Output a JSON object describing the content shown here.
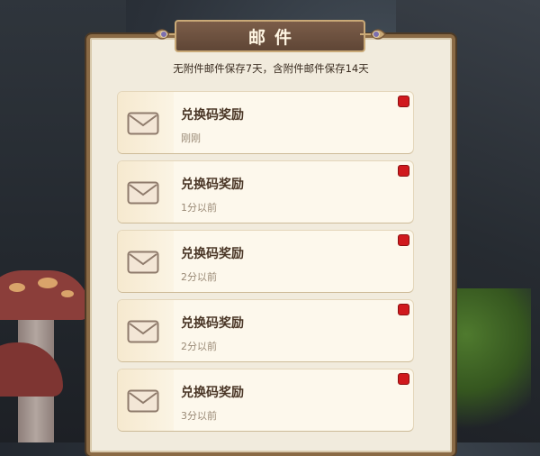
{
  "header": {
    "title": "邮件"
  },
  "notice": "无附件邮件保存7天，含附件邮件保存14天",
  "mails": [
    {
      "title": "兑换码奖励",
      "time": "刚刚",
      "unread": true
    },
    {
      "title": "兑换码奖励",
      "time": "1分以前",
      "unread": true
    },
    {
      "title": "兑换码奖励",
      "time": "2分以前",
      "unread": true
    },
    {
      "title": "兑换码奖励",
      "time": "2分以前",
      "unread": true
    },
    {
      "title": "兑换码奖励",
      "time": "3分以前",
      "unread": true
    }
  ],
  "icons": {
    "mail": "envelope-icon",
    "unread": "unread-badge-icon",
    "ornament": "ornament-icon"
  },
  "colors": {
    "panel": "#f1ebdd",
    "banner": "#6a4f3d",
    "unread": "#d0191d"
  }
}
